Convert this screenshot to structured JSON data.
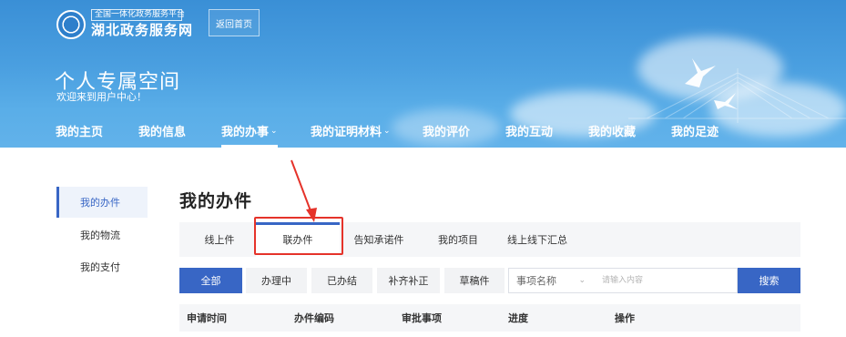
{
  "header": {
    "platform_sub": "全国一体化政务服务平台",
    "platform_name": "湖北政务服务网",
    "back_home": "返回首页",
    "space_title": "个人专属空间",
    "welcome": "欢迎来到用户中心！"
  },
  "nav": {
    "items": [
      {
        "label": "我的主页",
        "has_dropdown": false
      },
      {
        "label": "我的信息",
        "has_dropdown": false
      },
      {
        "label": "我的办事",
        "has_dropdown": true,
        "active": true
      },
      {
        "label": "我的证明材料",
        "has_dropdown": true
      },
      {
        "label": "我的评价",
        "has_dropdown": false
      },
      {
        "label": "我的互动",
        "has_dropdown": false
      },
      {
        "label": "我的收藏",
        "has_dropdown": false
      },
      {
        "label": "我的足迹",
        "has_dropdown": false
      }
    ],
    "dropdown_glyph": "⌄"
  },
  "sidebar": {
    "items": [
      {
        "label": "我的办件",
        "active": true
      },
      {
        "label": "我的物流",
        "active": false
      },
      {
        "label": "我的支付",
        "active": false
      }
    ]
  },
  "main": {
    "title": "我的办件",
    "tabs": [
      {
        "label": "线上件",
        "active": false
      },
      {
        "label": "联办件",
        "active": true
      },
      {
        "label": "告知承诺件",
        "active": false
      },
      {
        "label": "我的项目",
        "active": false
      },
      {
        "label": "线上线下汇总",
        "active": false
      }
    ],
    "filters": [
      {
        "label": "全部",
        "active": true
      },
      {
        "label": "办理中",
        "active": false
      },
      {
        "label": "已办结",
        "active": false
      },
      {
        "label": "补齐补正",
        "active": false
      },
      {
        "label": "草稿件",
        "active": false
      }
    ],
    "search": {
      "select_value": "事项名称",
      "placeholder": "请输入内容",
      "button_label": "搜索"
    },
    "table_headers": [
      "申请时间",
      "办件编码",
      "审批事项",
      "进度",
      "操作"
    ]
  },
  "colors": {
    "accent": "#3866c5",
    "header_blue": "#4a9fe0",
    "annotation_red": "#e5332a"
  }
}
